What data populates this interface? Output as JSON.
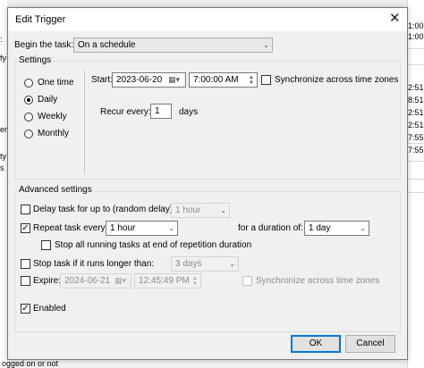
{
  "background": {
    "left_fragments": [
      ":",
      "fy",
      "er",
      "ty",
      "s"
    ],
    "right_times": [
      "1:00",
      "1:00",
      "2:51",
      "8:51:5",
      "2:51",
      "2:51",
      "7:55:5",
      "7:55:5"
    ],
    "footer_text": "ogged on or not"
  },
  "dialog": {
    "title": "Edit Trigger",
    "close_glyph": "✕",
    "begin_label": "Begin the task:",
    "begin_value": "On a schedule",
    "settings": {
      "group_label": "Settings",
      "radios": [
        {
          "label": "One time",
          "selected": false
        },
        {
          "label": "Daily",
          "selected": true
        },
        {
          "label": "Weekly",
          "selected": false
        },
        {
          "label": "Monthly",
          "selected": false
        }
      ],
      "start_label": "Start:",
      "start_date": "2023-06-20",
      "start_time": "7:00:00 AM",
      "sync_label": "Synchronize across time zones",
      "recur_label": "Recur every:",
      "recur_value": "1",
      "recur_unit": "days"
    },
    "advanced": {
      "group_label": "Advanced settings",
      "delay_label": "Delay task for up to (random delay):",
      "delay_value": "1 hour",
      "repeat_label": "Repeat task every:",
      "repeat_value": "1 hour",
      "duration_label": "for a duration of:",
      "duration_value": "1 day",
      "stop_running_label": "Stop all running tasks at end of repetition duration",
      "stop_longer_label": "Stop task if it runs longer than:",
      "stop_longer_value": "3 days",
      "expire_label": "Expire:",
      "expire_date": "2024-06-21",
      "expire_time": "12:45:49 PM",
      "expire_sync_label": "Synchronize across time zones",
      "enabled_label": "Enabled"
    },
    "ok_label": "OK",
    "cancel_label": "Cancel"
  }
}
